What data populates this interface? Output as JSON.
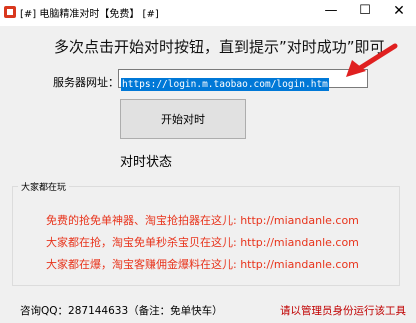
{
  "window": {
    "title": "[#] 电脑精准对时【免费】 [#]",
    "minimize_symbol": "—",
    "maximize_symbol": "☐",
    "close_symbol": "✕"
  },
  "main": {
    "hint": "多次点击开始对时按钮，直到提示”对时成功”即可",
    "url_label": "服务器网址：",
    "url_value": "https://login.m.taobao.com/login.htm",
    "sync_button": "开始对时",
    "status": "对时状态"
  },
  "promo": {
    "group_title": "大家都在玩",
    "lines": [
      "免费的抢免单神器、淘宝抢拍器在这儿: http://miandanle.com",
      "大家都在抢，淘宝免单秒杀宝贝在这儿: http://miandanle.com",
      "大家都在爆，淘宝客赚佣金爆料在这儿: http://miandanle.com"
    ],
    "color": "#e8341c"
  },
  "footer": {
    "contact": "咨询QQ：287144633（备注：免单快车）",
    "admin_notice": "请以管理员身份运行该工具",
    "notice_color": "#c00000"
  },
  "icons": {
    "app": "app-icon",
    "arrow": "arrow-icon"
  }
}
